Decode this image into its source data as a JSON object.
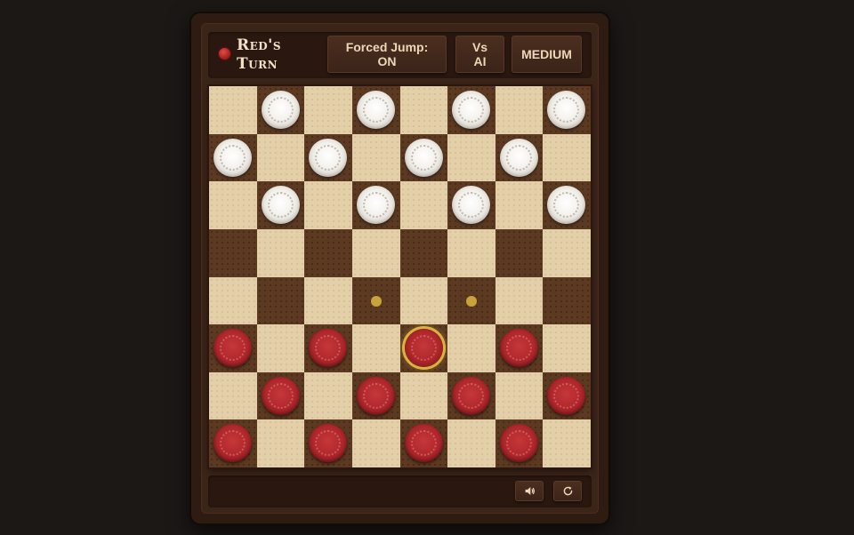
{
  "header": {
    "turn_label": "Red's Turn",
    "forced_jump_label": "Forced Jump:",
    "forced_jump_value": "ON",
    "mode_label_line1": "Vs",
    "mode_label_line2": "AI",
    "difficulty_label": "MEDIUM"
  },
  "colors": {
    "red_piece": "#b0282c",
    "white_piece": "#f3f1ec",
    "light_square": "#e3cfa8",
    "dark_square": "#5c3a22",
    "highlight": "#d9b340"
  },
  "board": {
    "size": 8,
    "pieces": [
      {
        "row": 0,
        "col": 1,
        "color": "white"
      },
      {
        "row": 0,
        "col": 3,
        "color": "white"
      },
      {
        "row": 0,
        "col": 5,
        "color": "white"
      },
      {
        "row": 0,
        "col": 7,
        "color": "white"
      },
      {
        "row": 1,
        "col": 0,
        "color": "white"
      },
      {
        "row": 1,
        "col": 2,
        "color": "white"
      },
      {
        "row": 1,
        "col": 4,
        "color": "white"
      },
      {
        "row": 1,
        "col": 6,
        "color": "white"
      },
      {
        "row": 2,
        "col": 1,
        "color": "white"
      },
      {
        "row": 2,
        "col": 3,
        "color": "white"
      },
      {
        "row": 2,
        "col": 5,
        "color": "white"
      },
      {
        "row": 2,
        "col": 7,
        "color": "white"
      },
      {
        "row": 5,
        "col": 0,
        "color": "red"
      },
      {
        "row": 5,
        "col": 2,
        "color": "red"
      },
      {
        "row": 5,
        "col": 4,
        "color": "red",
        "selected": true
      },
      {
        "row": 5,
        "col": 6,
        "color": "red"
      },
      {
        "row": 6,
        "col": 1,
        "color": "red"
      },
      {
        "row": 6,
        "col": 3,
        "color": "red"
      },
      {
        "row": 6,
        "col": 5,
        "color": "red"
      },
      {
        "row": 6,
        "col": 7,
        "color": "red"
      },
      {
        "row": 7,
        "col": 0,
        "color": "red"
      },
      {
        "row": 7,
        "col": 2,
        "color": "red"
      },
      {
        "row": 7,
        "col": 4,
        "color": "red"
      },
      {
        "row": 7,
        "col": 6,
        "color": "red"
      }
    ],
    "move_hints": [
      {
        "row": 4,
        "col": 3
      },
      {
        "row": 4,
        "col": 5
      }
    ]
  },
  "footer": {
    "sound_icon": "speaker-icon",
    "restart_icon": "restart-icon"
  }
}
